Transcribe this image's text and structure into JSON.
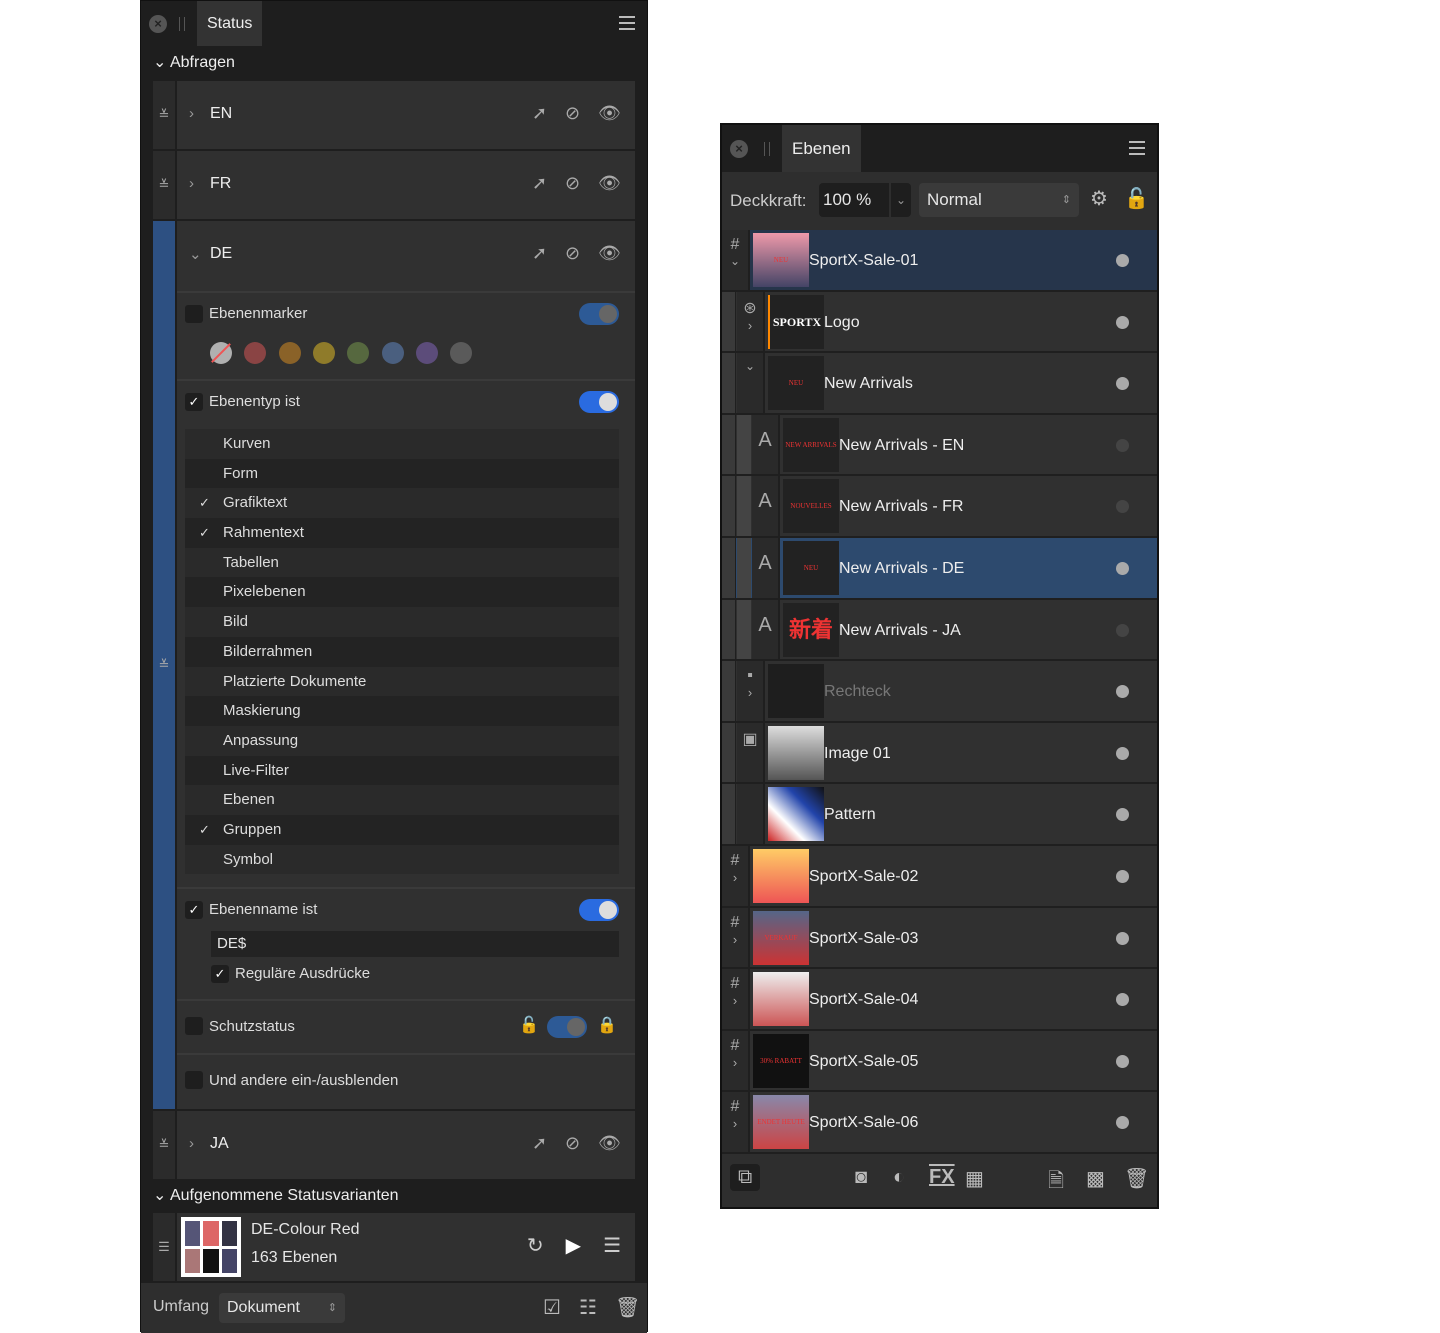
{
  "status_panel": {
    "tab": "Status",
    "queries_header": "Abfragen",
    "queries": [
      {
        "label": "EN",
        "expanded": false
      },
      {
        "label": "FR",
        "expanded": false
      },
      {
        "label": "DE",
        "expanded": true
      },
      {
        "label": "JA",
        "expanded": false
      }
    ],
    "de": {
      "marker": {
        "label": "Ebenenmarker",
        "checked": false,
        "toggle": "off",
        "colors": [
          "#b0b0b0",
          "#8a4444",
          "#8a6228",
          "#8f7b2a",
          "#56683f",
          "#4a5f7f",
          "#5c4c7a",
          "#5a5a5a"
        ]
      },
      "type": {
        "label": "Ebenentyp ist",
        "checked": true,
        "toggle": "on",
        "items": [
          {
            "label": "Kurven",
            "checked": false
          },
          {
            "label": "Form",
            "checked": false
          },
          {
            "label": "Grafiktext",
            "checked": true
          },
          {
            "label": "Rahmentext",
            "checked": true
          },
          {
            "label": "Tabellen",
            "checked": false
          },
          {
            "label": "Pixelebenen",
            "checked": false
          },
          {
            "label": "Bild",
            "checked": false
          },
          {
            "label": "Bilderrahmen",
            "checked": false
          },
          {
            "label": "Platzierte Dokumente",
            "checked": false
          },
          {
            "label": "Maskierung",
            "checked": false
          },
          {
            "label": "Anpassung",
            "checked": false
          },
          {
            "label": "Live-Filter",
            "checked": false
          },
          {
            "label": "Ebenen",
            "checked": false
          },
          {
            "label": "Gruppen",
            "checked": true
          },
          {
            "label": "Symbol",
            "checked": false
          }
        ]
      },
      "name": {
        "label": "Ebenenname ist",
        "checked": true,
        "toggle": "on",
        "value": "DE$",
        "regex_label": "Reguläre Ausdrücke",
        "regex_checked": true
      },
      "protect": {
        "label": "Schutzstatus",
        "checked": false
      },
      "others": {
        "label": "Und andere ein-/ausblenden",
        "checked": false
      }
    },
    "recorded_header": "Aufgenommene Statusvarianten",
    "variant": {
      "name": "DE-Colour Red",
      "count": "163 Ebenen"
    },
    "footer": {
      "scope_label": "Umfang",
      "scope_value": "Dokument"
    }
  },
  "layers_panel": {
    "tab": "Ebenen",
    "opacity_label": "Deckkraft:",
    "opacity_value": "100 %",
    "blend_mode": "Normal",
    "accent": "#2d4a6e",
    "layers": [
      {
        "name": "SportX-Sale-01",
        "level": 0,
        "icon": "artboard-icon",
        "expanded": true,
        "selected": "parent",
        "thumb": "NEU EINGETROFFEN"
      },
      {
        "name": "Logo",
        "level": 1,
        "icon": "symbol-icon",
        "expanded": false,
        "thumb": "SPORTX"
      },
      {
        "name": "New Arrivals",
        "level": 1,
        "icon": "group-icon",
        "expanded": true,
        "thumb": "NEU EINGETROFFEN"
      },
      {
        "name": "New Arrivals - EN",
        "level": 2,
        "icon": "text-icon",
        "hidden": true,
        "thumb": "NEW ARRIVALS"
      },
      {
        "name": "New Arrivals - FR",
        "level": 2,
        "icon": "text-icon",
        "hidden": true,
        "thumb": "NOUVELLES ARRIVÉES"
      },
      {
        "name": "New Arrivals - DE",
        "level": 2,
        "icon": "text-icon",
        "selected": "yes",
        "thumb": "NEU EINGETROFFEN"
      },
      {
        "name": "New Arrivals - JA",
        "level": 2,
        "icon": "text-icon",
        "hidden": true,
        "thumb": "新着"
      },
      {
        "name": "Rechteck",
        "level": 1,
        "icon": "shapes-icon",
        "expanded": false,
        "dimmed": true,
        "thumb": ""
      },
      {
        "name": "Image 01",
        "level": 1,
        "icon": "image-icon",
        "thumb": ""
      },
      {
        "name": "Pattern",
        "level": 1,
        "icon": "embed-icon",
        "thumb": ""
      },
      {
        "name": "SportX-Sale-02",
        "level": 0,
        "icon": "artboard-icon",
        "expanded": false,
        "thumb": ""
      },
      {
        "name": "SportX-Sale-03",
        "level": 0,
        "icon": "artboard-icon",
        "expanded": false,
        "thumb": "VERKAUF ENDET HEUTE"
      },
      {
        "name": "SportX-Sale-04",
        "level": 0,
        "icon": "artboard-icon",
        "expanded": false,
        "thumb": ""
      },
      {
        "name": "SportX-Sale-05",
        "level": 0,
        "icon": "artboard-icon",
        "expanded": false,
        "thumb": "30% RABATT"
      },
      {
        "name": "SportX-Sale-06",
        "level": 0,
        "icon": "artboard-icon",
        "expanded": false,
        "thumb": "ENDET HEUTE"
      }
    ]
  }
}
